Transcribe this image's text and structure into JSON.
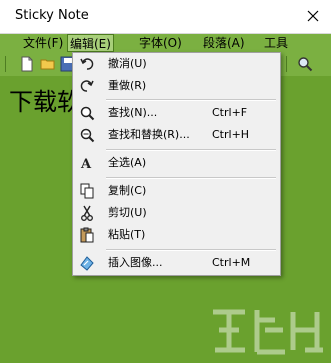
{
  "window": {
    "title": "Sticky Note"
  },
  "menubar": {
    "items": [
      {
        "label": "文件(F)"
      },
      {
        "label": "编辑(E)"
      },
      {
        "label": "字体(O)"
      },
      {
        "label": "段落(A)"
      },
      {
        "label": "工具"
      }
    ]
  },
  "toolbar": {
    "icons": [
      "new-document-icon",
      "open-folder-icon",
      "save-icon",
      "search-icon"
    ]
  },
  "editor": {
    "text": "下载软"
  },
  "edit_menu": {
    "items": [
      {
        "label": "撤消(U)",
        "shortcut": "",
        "icon": "undo-icon"
      },
      {
        "label": "重做(R)",
        "shortcut": "",
        "icon": "redo-icon"
      },
      {
        "label": "查找(N)...",
        "shortcut": "Ctrl+F",
        "icon": "find-icon"
      },
      {
        "label": "查找和替换(R)...",
        "shortcut": "Ctrl+H",
        "icon": "find-replace-icon"
      },
      {
        "label": "全选(A)",
        "shortcut": "",
        "icon": "select-all-icon"
      },
      {
        "label": "复制(C)",
        "shortcut": "",
        "icon": "copy-icon"
      },
      {
        "label": "剪切(U)",
        "shortcut": "",
        "icon": "cut-icon"
      },
      {
        "label": "粘贴(T)",
        "shortcut": "",
        "icon": "paste-icon"
      },
      {
        "label": "插入图像...",
        "shortcut": "Ctrl+M",
        "icon": "insert-image-icon"
      }
    ]
  },
  "colors": {
    "window_bg": "#6aa12e",
    "bar_bg": "#7bb041",
    "menu_bg": "#f0f0f0",
    "menu_active": "#a8cf7a"
  },
  "watermark": {
    "icon": "site-watermark-logo"
  }
}
